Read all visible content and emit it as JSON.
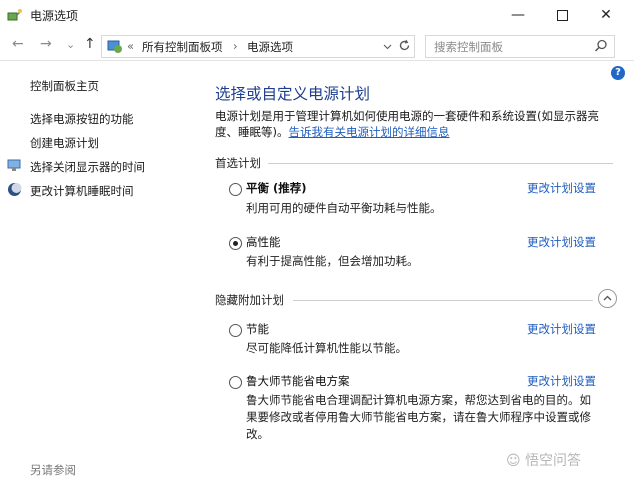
{
  "window": {
    "title": "电源选项"
  },
  "nav": {
    "back": "←",
    "forward": "→",
    "recent": "⌄",
    "up": "↑",
    "breadcrumb_sep_start": "«",
    "breadcrumb": [
      "所有控制面板项",
      "电源选项"
    ],
    "breadcrumb_sep": "›",
    "search_placeholder": "搜索控制面板"
  },
  "sidebar": {
    "home": "控制面板主页",
    "items": [
      {
        "label": "选择电源按钮的功能"
      },
      {
        "label": "创建电源计划"
      },
      {
        "label": "选择关闭显示器的时间",
        "icon": "monitor-icon"
      },
      {
        "label": "更改计算机睡眠时间",
        "icon": "moon-icon"
      }
    ],
    "see_also": "另请参阅"
  },
  "main": {
    "title": "选择或自定义电源计划",
    "desc": "电源计划是用于管理计算机如何使用电源的一套硬件和系统设置(如显示器亮度、睡眠等)。",
    "desc_link": "告诉我有关电源计划的详细信息",
    "preferred_label": "首选计划",
    "hidden_label": "隐藏附加计划",
    "change_label": "更改计划设置",
    "plans": [
      {
        "name": "平衡 (推荐)",
        "desc": "利用可用的硬件自动平衡功耗与性能。",
        "selected": false
      },
      {
        "name": "高性能",
        "desc": "有利于提高性能，但会增加功耗。",
        "selected": true
      },
      {
        "name": "节能",
        "desc": "尽可能降低计算机性能以节能。",
        "selected": false
      },
      {
        "name": "鲁大师节能省电方案",
        "desc": "鲁大师节能省电合理调配计算机电源方案，帮您达到省电的目的。如果要修改或者停用鲁大师节能省电方案，请在鲁大师程序中设置或修改。",
        "selected": false
      }
    ]
  },
  "watermark": "悟空问答",
  "colors": {
    "link": "#1f5dbf",
    "heading": "#1e3f8f",
    "help": "#1f68c7"
  }
}
